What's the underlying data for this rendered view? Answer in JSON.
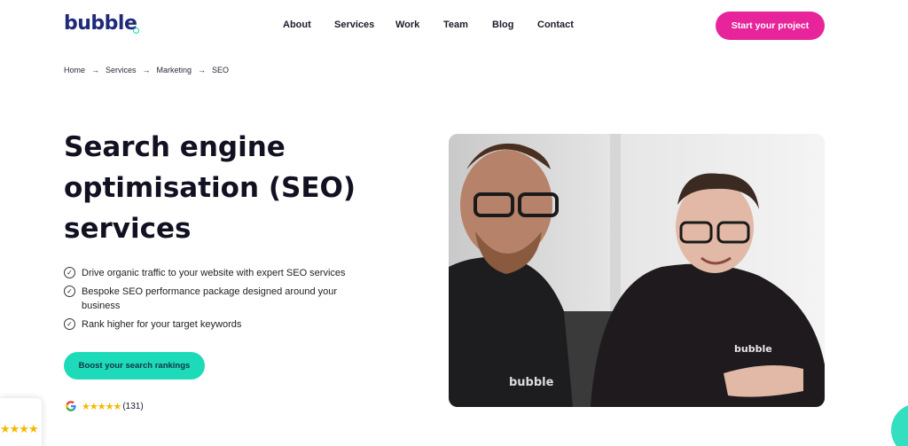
{
  "header": {
    "logo_text": "bubble",
    "nav": [
      {
        "label": "About"
      },
      {
        "label": "Services"
      },
      {
        "label": "Work"
      },
      {
        "label": "Team"
      },
      {
        "label": "Blog"
      },
      {
        "label": "Contact"
      }
    ],
    "cta_label": "Start your project"
  },
  "breadcrumb": [
    "Home",
    "Services",
    "Marketing",
    "SEO"
  ],
  "breadcrumb_separator": "→",
  "hero": {
    "title": "Search engine optimisation (SEO) services",
    "features": [
      "Drive organic traffic to your website with expert SEO services",
      "Bespoke SEO performance package designed around your business",
      "Rank higher for your target keywords"
    ],
    "button_label": "Boost your search rankings",
    "rating_stars": "★★★★★",
    "review_count": "(131)",
    "photo_shirt_text_left": "bubble",
    "photo_shirt_text_right": "bubble"
  },
  "widget": {
    "stars": "★★★★"
  },
  "icons": [
    "check-circle-icon",
    "google-icon",
    "star-icon",
    "arrow-right-icon"
  ],
  "colors": {
    "primary_pink": "#e8249a",
    "accent_teal": "#1ddbb8",
    "logo_blue": "#1f2a7a",
    "star_yellow": "#f5b800"
  }
}
